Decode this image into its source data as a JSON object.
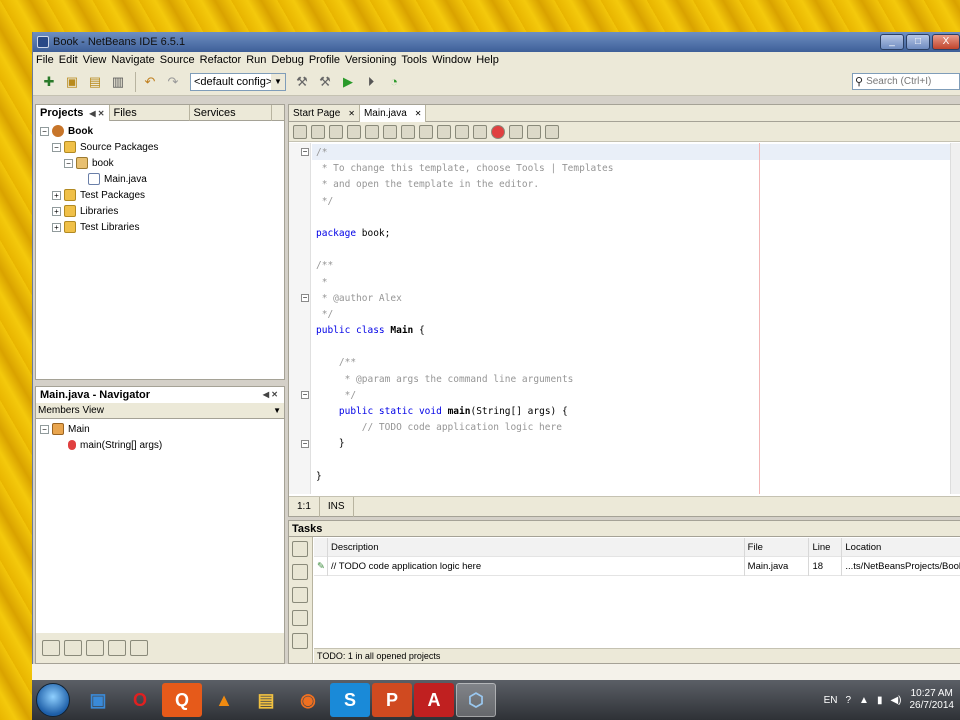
{
  "window": {
    "title": "Book - NetBeans IDE 6.5.1",
    "min_label": "_",
    "max_label": "□",
    "close_label": "X"
  },
  "menu": [
    "File",
    "Edit",
    "View",
    "Navigate",
    "Source",
    "Refactor",
    "Run",
    "Debug",
    "Profile",
    "Versioning",
    "Tools",
    "Window",
    "Help"
  ],
  "toolbar": {
    "config": "<default config>",
    "search_placeholder": "Search (Ctrl+I)"
  },
  "projects_panel": {
    "tabs": [
      "Projects",
      "Files",
      "Services"
    ],
    "tree": [
      {
        "label": "Book",
        "level": 0,
        "expanded": true,
        "icon": "coffee-cup-icon",
        "bold": true
      },
      {
        "label": "Source Packages",
        "level": 1,
        "expanded": true,
        "icon": "folder-icon"
      },
      {
        "label": "book",
        "level": 2,
        "expanded": true,
        "icon": "package-icon"
      },
      {
        "label": "Main.java",
        "level": 3,
        "icon": "java-file-icon"
      },
      {
        "label": "Test Packages",
        "level": 1,
        "expanded": false,
        "icon": "folder-icon"
      },
      {
        "label": "Libraries",
        "level": 1,
        "expanded": false,
        "icon": "folder-icon"
      },
      {
        "label": "Test Libraries",
        "level": 1,
        "expanded": false,
        "icon": "folder-icon"
      }
    ]
  },
  "navigator": {
    "title": "Main.java - Navigator",
    "view": "Members View",
    "class_name": "Main",
    "method": "main(String[] args)"
  },
  "editor": {
    "tabs": [
      "Start Page",
      "Main.java"
    ],
    "active_tab": "Main.java",
    "lines": [
      "/*",
      " * To change this template, choose Tools | Templates",
      " * and open the template in the editor.",
      " */",
      "",
      "package book;",
      "",
      "/**",
      " *",
      " * @author Alex",
      " */",
      "public class Main {",
      "",
      "    /**",
      "     * @param args the command line arguments",
      "     */",
      "    public static void main(String[] args) {",
      "        // TODO code application logic here",
      "    }",
      "",
      "}"
    ],
    "status_position": "1:1",
    "status_mode": "INS"
  },
  "tasks": {
    "title": "Tasks",
    "columns": [
      "Description",
      "File",
      "Line",
      "Location"
    ],
    "rows": [
      {
        "description": "// TODO code application logic here",
        "file": "Main.java",
        "line": "18",
        "location": "...ts/NetBeansProjects/Book/src/bo"
      }
    ],
    "footer_label": "TODO:",
    "footer_text": " 1 in all opened projects"
  },
  "taskbar": {
    "lang": "EN",
    "time": "10:27 AM",
    "date": "26/7/2014"
  },
  "colors": {
    "keyword": "#0000e6",
    "comment": "#969696",
    "background_yellow": "#f4c90c"
  }
}
